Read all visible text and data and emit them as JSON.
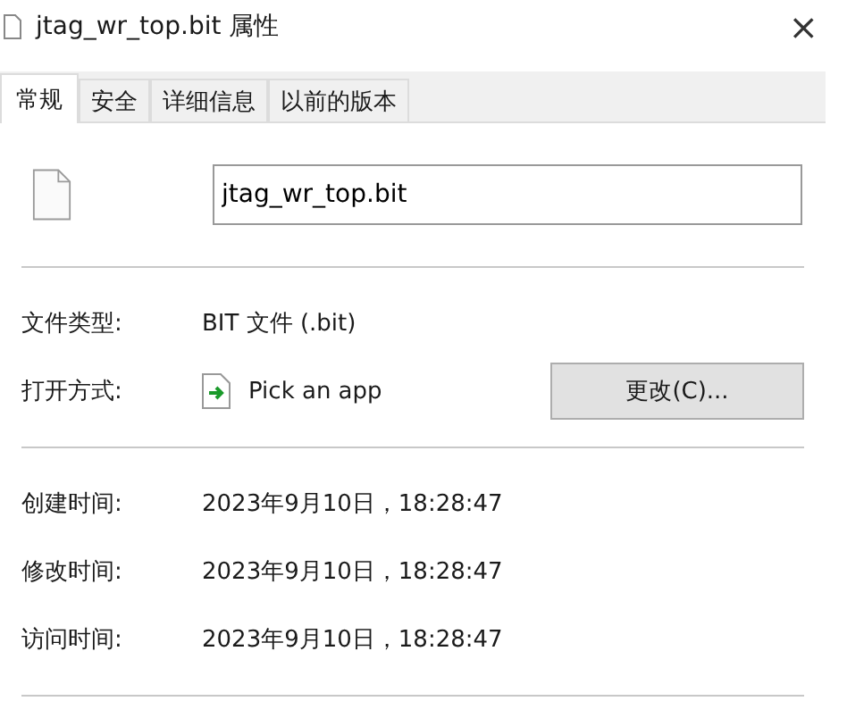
{
  "window": {
    "title": "jtag_wr_top.bit 属性",
    "close": "×"
  },
  "tabs": [
    {
      "label": "常规",
      "selected": true
    },
    {
      "label": "安全",
      "selected": false
    },
    {
      "label": "详细信息",
      "selected": false
    },
    {
      "label": "以前的版本",
      "selected": false
    }
  ],
  "file_name": {
    "value": "jtag_wr_top.bit"
  },
  "type_row": {
    "label": "文件类型:",
    "value": "BIT 文件 (.bit)"
  },
  "open_with": {
    "label": "打开方式:",
    "value": "Pick an app",
    "button": "更改(C)..."
  },
  "times": [
    {
      "label": "创建时间:",
      "value": "2023年9月10日，18:28:47"
    },
    {
      "label": "修改时间:",
      "value": "2023年9月10日，18:28:47"
    },
    {
      "label": "访问时间:",
      "value": "2023年9月10日，18:28:47"
    }
  ]
}
